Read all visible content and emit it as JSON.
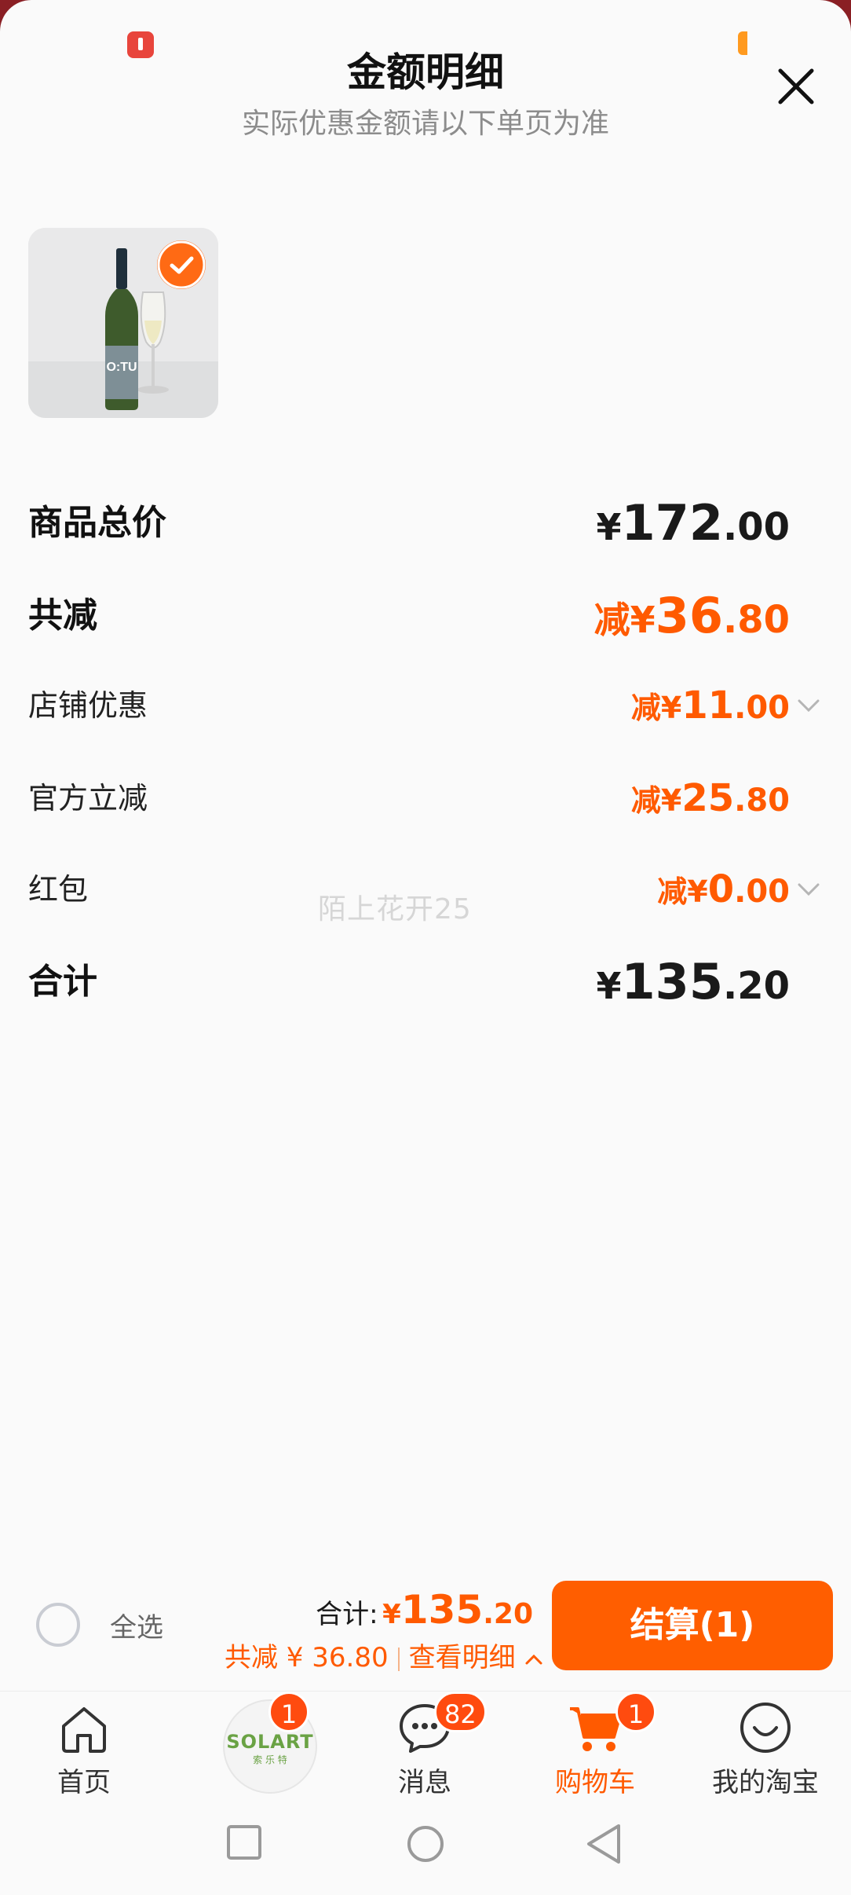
{
  "header": {
    "title": "金额明细",
    "subtitle": "实际优惠金额请以下单页为准"
  },
  "product": {
    "bottle_label": "O:TU"
  },
  "rows": {
    "total_price": {
      "label": "商品总价",
      "pre": "¥",
      "int": "172",
      "dec": ".00"
    },
    "total_discount": {
      "label": "共减",
      "pre": "减¥",
      "int": "36",
      "dec": ".80"
    },
    "store_discount": {
      "label": "店铺优惠",
      "pre": "减¥",
      "int": "11",
      "dec": ".00"
    },
    "official_discount": {
      "label": "官方立减",
      "pre": "减¥",
      "int": "25",
      "dec": ".80"
    },
    "red_packet": {
      "label": "红包",
      "pre": "减¥",
      "int": "0",
      "dec": ".00"
    },
    "sum": {
      "label": "合计",
      "pre": "¥",
      "int": "135",
      "dec": ".20"
    }
  },
  "watermark": "陌上花开25",
  "bottom_bar": {
    "select_all": "全选",
    "total_label": "合计:",
    "total_pre": "¥",
    "total_int": "135",
    "total_dec": ".20",
    "saving_text": "共减 ¥ 36.80",
    "view_detail": "查看明细",
    "checkout": "结算(1)"
  },
  "nav": {
    "home": {
      "label": "首页"
    },
    "solart": {
      "logo": "SOLART",
      "logo_sub": "索 乐 特",
      "badge": "1"
    },
    "messages": {
      "label": "消息",
      "badge": "82"
    },
    "cart": {
      "label": "购物车",
      "badge": "1"
    },
    "my": {
      "label": "我的淘宝"
    }
  },
  "colors": {
    "accent": "#ff5a00",
    "checkout_bg": "#ff5e00",
    "badge": "#ff4b0f"
  }
}
